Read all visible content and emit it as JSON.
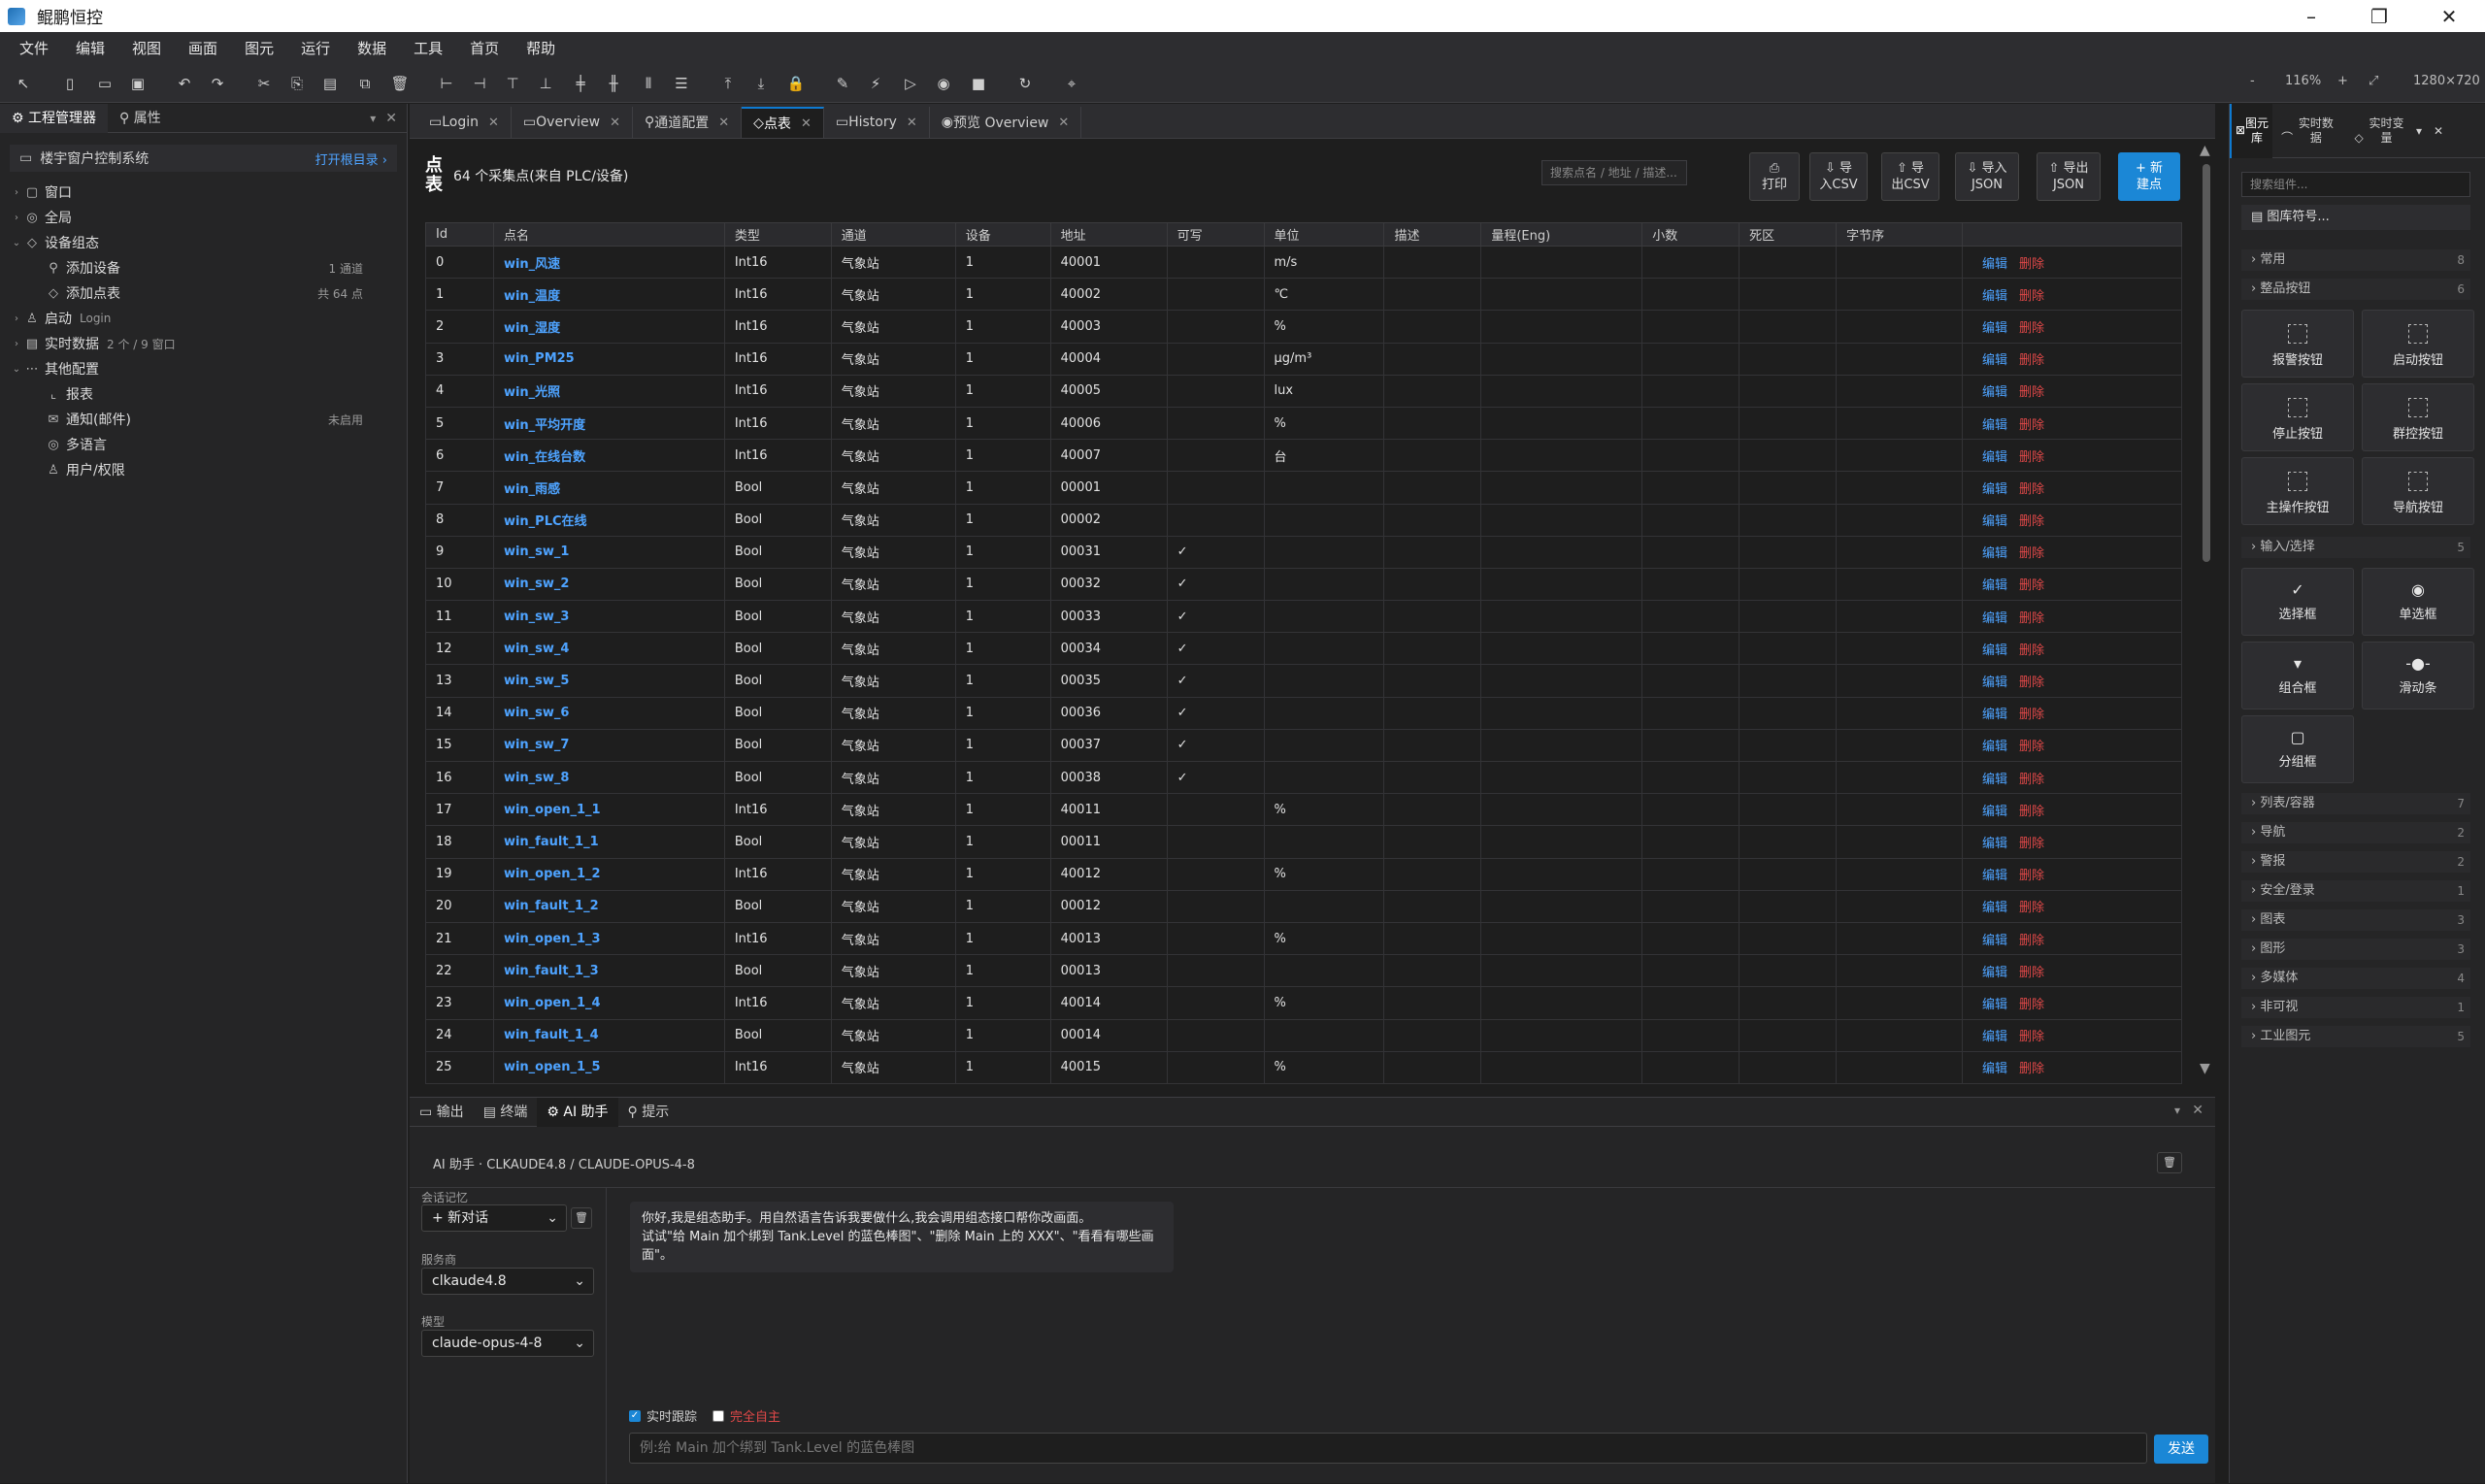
{
  "app": {
    "title": "鲲鹏恒控"
  },
  "menu": [
    "文件",
    "编辑",
    "视图",
    "画面",
    "图元",
    "运行",
    "数据",
    "工具",
    "首页",
    "帮助"
  ],
  "toolbar": {
    "zoom": "116%",
    "resolution": "1280×720",
    "zoom_minus": "-",
    "zoom_plus": "+"
  },
  "left": {
    "tabs": [
      "工程管理器",
      "属性"
    ],
    "project": "楼宇窗户控制系统",
    "open_dir": "打开根目录 ›",
    "tree": [
      {
        "label": "窗口",
        "indent": 0,
        "icon": "▢",
        "twisty": "›"
      },
      {
        "label": "全局",
        "indent": 0,
        "icon": "◎",
        "twisty": "›"
      },
      {
        "label": "设备组态",
        "indent": 0,
        "icon": "◇",
        "twisty": "⌄"
      },
      {
        "label": "添加设备",
        "indent": 1,
        "icon": "⚲",
        "twisty": "",
        "right": "1 通道"
      },
      {
        "label": "添加点表",
        "indent": 1,
        "icon": "◇",
        "twisty": "",
        "right": "共 64 点"
      },
      {
        "label": "启动",
        "indent": 0,
        "icon": "♙",
        "twisty": "›",
        "meta": "Login"
      },
      {
        "label": "实时数据",
        "indent": 0,
        "icon": "▤",
        "twisty": "›",
        "meta": "2 个 / 9 窗口"
      },
      {
        "label": "其他配置",
        "indent": 0,
        "icon": "⋯",
        "twisty": "⌄"
      },
      {
        "label": "报表",
        "indent": 1,
        "icon": "⌞",
        "twisty": ""
      },
      {
        "label": "通知(邮件)",
        "indent": 1,
        "icon": "✉",
        "twisty": "",
        "right": "未启用"
      },
      {
        "label": "多语言",
        "indent": 1,
        "icon": "◎",
        "twisty": ""
      },
      {
        "label": "用户/权限",
        "indent": 1,
        "icon": "♙",
        "twisty": ""
      }
    ]
  },
  "doctabs": [
    {
      "label": "Login",
      "icon": "▭"
    },
    {
      "label": "Overview",
      "icon": "▭"
    },
    {
      "label": "通道配置",
      "icon": "⚲"
    },
    {
      "label": "点表",
      "icon": "◇",
      "active": true
    },
    {
      "label": "History",
      "icon": "▭"
    },
    {
      "label": "预览 Overview",
      "icon": "◉"
    }
  ],
  "points": {
    "title": "点表",
    "count": "64 个采集点(来自 PLC/设备)",
    "search_placeholder": "搜索点名 / 地址 / 描述...",
    "buttons": [
      {
        "icon": "⎙",
        "label": "打印"
      },
      {
        "icon": "⇩ 导",
        "label": "入CSV"
      },
      {
        "icon": "⇧ 导",
        "label": "出CSV"
      },
      {
        "icon": "⇩ 导入",
        "label": "JSON"
      },
      {
        "icon": "⇧ 导出",
        "label": "JSON"
      },
      {
        "icon": "+ 新",
        "label": "建点"
      }
    ],
    "columns": [
      "Id",
      "点名",
      "类型",
      "通道",
      "设备",
      "地址",
      "可写",
      "单位",
      "描述",
      "量程(Eng)",
      "小数",
      "死区",
      "字节序",
      ""
    ],
    "edit_label": "编辑",
    "delete_label": "删除",
    "rows": [
      [
        "0",
        "win_风速",
        "Int16",
        "气象站",
        "1",
        "40001",
        "",
        "m/s"
      ],
      [
        "1",
        "win_温度",
        "Int16",
        "气象站",
        "1",
        "40002",
        "",
        "℃"
      ],
      [
        "2",
        "win_湿度",
        "Int16",
        "气象站",
        "1",
        "40003",
        "",
        "%"
      ],
      [
        "3",
        "win_PM25",
        "Int16",
        "气象站",
        "1",
        "40004",
        "",
        "μg/m³"
      ],
      [
        "4",
        "win_光照",
        "Int16",
        "气象站",
        "1",
        "40005",
        "",
        "lux"
      ],
      [
        "5",
        "win_平均开度",
        "Int16",
        "气象站",
        "1",
        "40006",
        "",
        "%"
      ],
      [
        "6",
        "win_在线台数",
        "Int16",
        "气象站",
        "1",
        "40007",
        "",
        "台"
      ],
      [
        "7",
        "win_雨感",
        "Bool",
        "气象站",
        "1",
        "00001",
        "",
        ""
      ],
      [
        "8",
        "win_PLC在线",
        "Bool",
        "气象站",
        "1",
        "00002",
        "",
        ""
      ],
      [
        "9",
        "win_sw_1",
        "Bool",
        "气象站",
        "1",
        "00031",
        "✓",
        ""
      ],
      [
        "10",
        "win_sw_2",
        "Bool",
        "气象站",
        "1",
        "00032",
        "✓",
        ""
      ],
      [
        "11",
        "win_sw_3",
        "Bool",
        "气象站",
        "1",
        "00033",
        "✓",
        ""
      ],
      [
        "12",
        "win_sw_4",
        "Bool",
        "气象站",
        "1",
        "00034",
        "✓",
        ""
      ],
      [
        "13",
        "win_sw_5",
        "Bool",
        "气象站",
        "1",
        "00035",
        "✓",
        ""
      ],
      [
        "14",
        "win_sw_6",
        "Bool",
        "气象站",
        "1",
        "00036",
        "✓",
        ""
      ],
      [
        "15",
        "win_sw_7",
        "Bool",
        "气象站",
        "1",
        "00037",
        "✓",
        ""
      ],
      [
        "16",
        "win_sw_8",
        "Bool",
        "气象站",
        "1",
        "00038",
        "✓",
        ""
      ],
      [
        "17",
        "win_open_1_1",
        "Int16",
        "气象站",
        "1",
        "40011",
        "",
        "%"
      ],
      [
        "18",
        "win_fault_1_1",
        "Bool",
        "气象站",
        "1",
        "00011",
        "",
        ""
      ],
      [
        "19",
        "win_open_1_2",
        "Int16",
        "气象站",
        "1",
        "40012",
        "",
        "%"
      ],
      [
        "20",
        "win_fault_1_2",
        "Bool",
        "气象站",
        "1",
        "00012",
        "",
        ""
      ],
      [
        "21",
        "win_open_1_3",
        "Int16",
        "气象站",
        "1",
        "40013",
        "",
        "%"
      ],
      [
        "22",
        "win_fault_1_3",
        "Bool",
        "气象站",
        "1",
        "00013",
        "",
        ""
      ],
      [
        "23",
        "win_open_1_4",
        "Int16",
        "气象站",
        "1",
        "40014",
        "",
        "%"
      ],
      [
        "24",
        "win_fault_1_4",
        "Bool",
        "气象站",
        "1",
        "00014",
        "",
        ""
      ],
      [
        "25",
        "win_open_1_5",
        "Int16",
        "气象站",
        "1",
        "40015",
        "",
        "%"
      ]
    ]
  },
  "bottom": {
    "tabs": [
      "输出",
      "终端",
      "AI 助手",
      "提示"
    ],
    "ai_header": "AI 助手 · CLKAUDE4.8 / CLAUDE-OPUS-4-8",
    "memory_label": "会话记忆",
    "new_chat": "+ 新对话",
    "provider_label": "服务商",
    "provider_value": "clkaude4.8",
    "model_label": "模型",
    "model_value": "claude-opus-4-8",
    "message_line1": "你好,我是组态助手。用自然语言告诉我要做什么,我会调用组态接口帮你改画面。",
    "message_line2": "试试\"给 Main 加个绑到 Tank.Level 的蓝色棒图\"、\"删除 Main 上的 XXX\"、\"看看有哪些画面\"。",
    "opt_follow": "实时跟踪",
    "opt_auto": "完全自主",
    "input_placeholder": "例:给 Main 加个绑到 Tank.Level 的蓝色棒图",
    "send_label": "发送"
  },
  "right": {
    "tabs": [
      "图元库",
      "实时数据",
      "实时变量"
    ],
    "search_placeholder": "搜索组件...",
    "symbol_lib": "图库符号...",
    "categories": [
      {
        "label": "常用",
        "n": "8"
      },
      {
        "label": "整品按钮",
        "n": "6"
      },
      {
        "label": "输入/选择",
        "n": "5"
      },
      {
        "label": "列表/容器",
        "n": "7"
      },
      {
        "label": "导航",
        "n": "2"
      },
      {
        "label": "警报",
        "n": "2"
      },
      {
        "label": "安全/登录",
        "n": "1"
      },
      {
        "label": "图表",
        "n": "3"
      },
      {
        "label": "图形",
        "n": "3"
      },
      {
        "label": "多媒体",
        "n": "4"
      },
      {
        "label": "非可视",
        "n": "1"
      },
      {
        "label": "工业图元",
        "n": "5"
      }
    ],
    "button_tiles": [
      "报警按钮",
      "启动按钮",
      "停止按钮",
      "群控按钮",
      "主操作按钮",
      "导航按钮"
    ],
    "input_tiles": [
      {
        "label": "选择框",
        "glyph": "✓"
      },
      {
        "label": "单选框",
        "glyph": "◉"
      },
      {
        "label": "组合框",
        "glyph": "▾"
      },
      {
        "label": "滑动条",
        "glyph": "-●-"
      },
      {
        "label": "分组框",
        "glyph": "▢"
      }
    ]
  }
}
